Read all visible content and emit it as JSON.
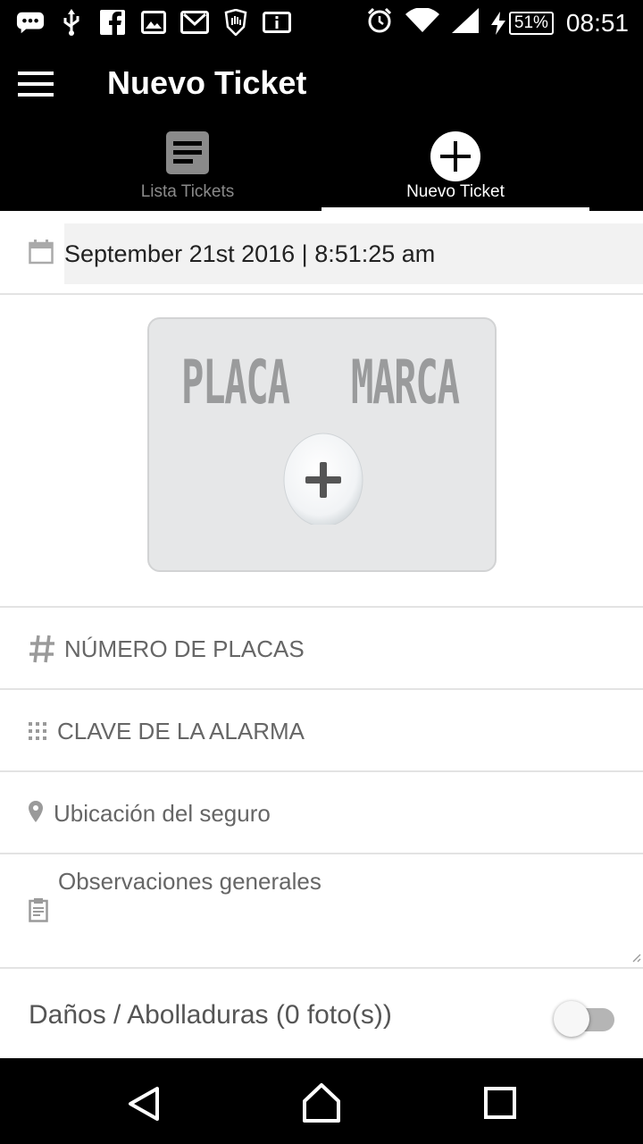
{
  "status_bar": {
    "left_icons": [
      "message-icon",
      "usb-icon",
      "facebook-icon",
      "image-icon",
      "gmail-icon",
      "hand-icon",
      "info-icon"
    ],
    "right_icons": [
      "alarm-icon",
      "wifi-icon",
      "signal-icon",
      "charging-icon"
    ],
    "battery": "51%",
    "time": "08:51"
  },
  "app_bar": {
    "title": "Nuevo Ticket",
    "tabs": [
      {
        "label": "Lista Tickets",
        "icon": "list-icon",
        "active": false
      },
      {
        "label": "Nuevo Ticket",
        "icon": "add-circle-icon",
        "active": true
      }
    ]
  },
  "form": {
    "date_value": "September 21st 2016 | 8:51:25 am",
    "plate_image": {
      "left_text": "PLACA",
      "right_text": "MARCA"
    },
    "plates_placeholder": "NÚMERO DE PLACAS",
    "alarm_placeholder": "CLAVE DE LA ALARMA",
    "location_placeholder": "Ubicación del seguro",
    "observations_placeholder": "Observaciones generales",
    "damage_label": "Daños / Abolladuras (0 foto(s))",
    "damage_toggle_on": false
  },
  "nav_bar": {
    "buttons": [
      "back-icon",
      "home-icon",
      "recents-icon"
    ]
  },
  "colors": {
    "bar_background": "#000000",
    "field_background": "#f2f2f2",
    "divider": "#e3e3e3"
  }
}
